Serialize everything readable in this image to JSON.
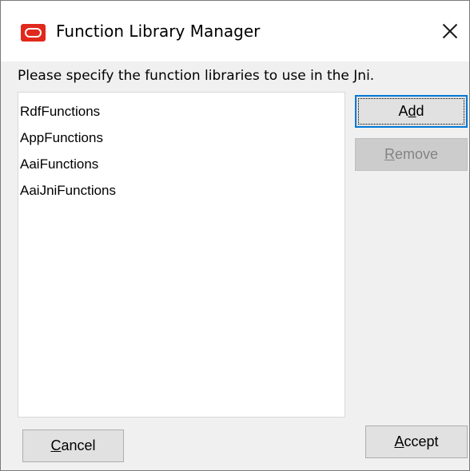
{
  "window": {
    "title": "Function Library Manager",
    "close_glyph": "close-icon"
  },
  "dialog": {
    "instruction": "Please specify the function libraries to use in the Jni."
  },
  "library_list": {
    "items": [
      {
        "label": "RdfFunctions"
      },
      {
        "label": "AppFunctions"
      },
      {
        "label": "AaiFunctions"
      },
      {
        "label": "AaiJniFunctions"
      }
    ]
  },
  "buttons": {
    "add": {
      "pre": "A",
      "mnemonic": "d",
      "post": "d",
      "state": "default"
    },
    "remove": {
      "pre": "",
      "mnemonic": "R",
      "post": "emove",
      "state": "disabled"
    },
    "cancel": {
      "pre": "",
      "mnemonic": "C",
      "post": "ancel",
      "state": "enabled"
    },
    "accept": {
      "pre": "",
      "mnemonic": "A",
      "post": "ccept",
      "state": "enabled"
    }
  },
  "colors": {
    "icon_red": "#e0291c",
    "focus_blue": "#0078d7",
    "disabled_text": "#838383"
  }
}
